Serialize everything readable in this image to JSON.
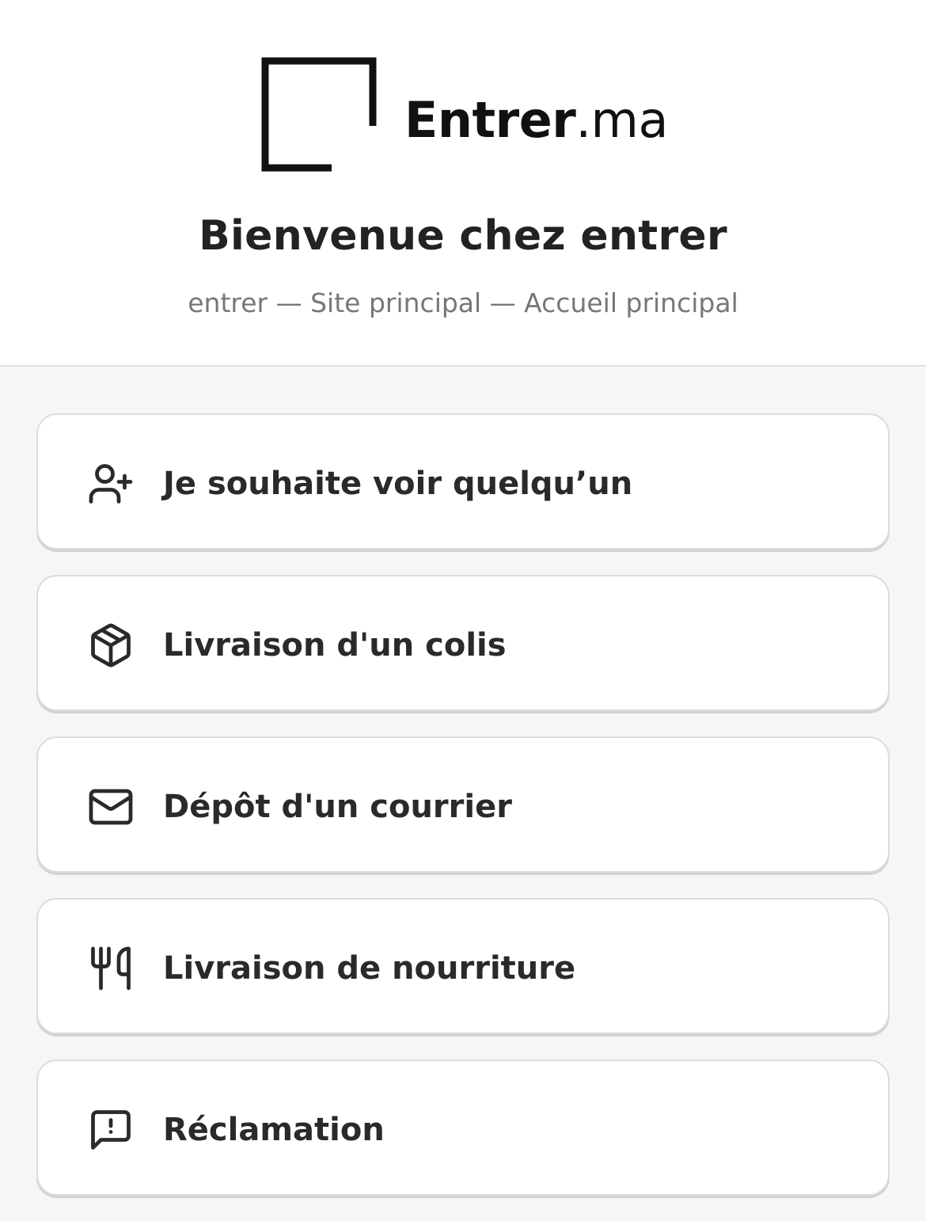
{
  "brand": {
    "name_bold": "Entrer",
    "name_suffix": ".ma"
  },
  "welcome": {
    "title": "Bienvenue chez entrer",
    "subtitle": "entrer — Site principal — Accueil principal"
  },
  "options": [
    {
      "label": "Je souhaite voir quelqu’un",
      "icon": "user-plus-icon"
    },
    {
      "label": "Livraison d'un colis",
      "icon": "package-icon"
    },
    {
      "label": "Dépôt d'un courrier",
      "icon": "mail-icon"
    },
    {
      "label": "Livraison de nourriture",
      "icon": "utensils-icon"
    },
    {
      "label": "Réclamation",
      "icon": "message-alert-icon"
    }
  ],
  "colors": {
    "background": "#f6f6f4",
    "card": "#ffffff",
    "text": "#222222",
    "muted": "#777777"
  }
}
